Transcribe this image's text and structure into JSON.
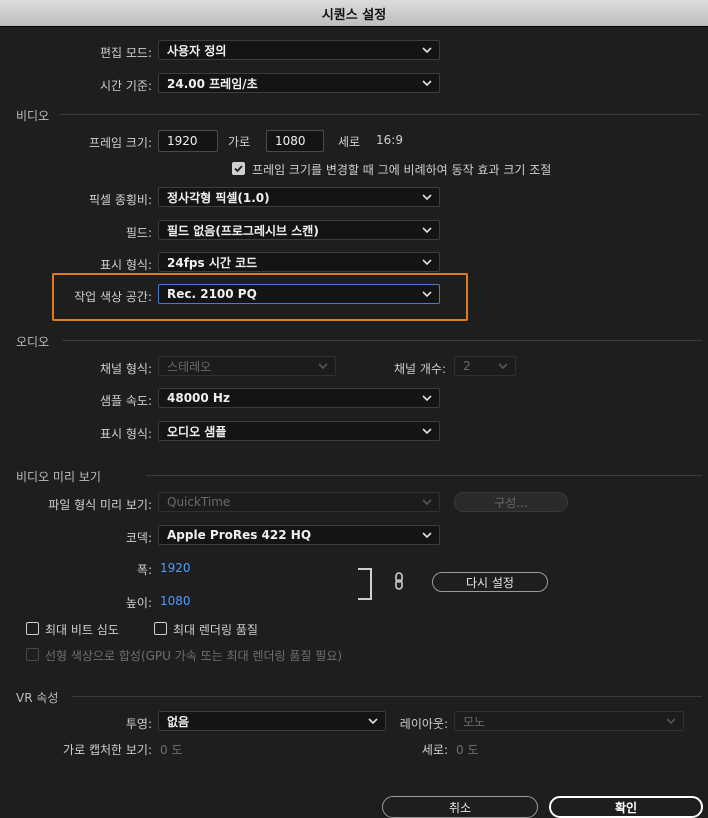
{
  "window": {
    "title": "시퀀스 설정"
  },
  "general": {
    "edit_mode_label": "편집 모드:",
    "edit_mode_value": "사용자 정의",
    "timebase_label": "시간 기준:",
    "timebase_value": "24.00  프레임/초"
  },
  "video": {
    "section_title": "비디오",
    "frame_size_label": "프레임 크기:",
    "frame_width": "1920",
    "horizontal_label": "가로",
    "frame_height": "1080",
    "vertical_label": "세로",
    "aspect": "16:9",
    "scale_checkbox_label": "프레임 크기를 변경할 때 그에 비례하여 동작 효과 크기 조절",
    "scale_checked": true,
    "pixel_aspect_label": "픽셀 종횡비:",
    "pixel_aspect_value": "정사각형 픽셀(1.0)",
    "fields_label": "필드:",
    "fields_value": "필드 없음(프로그레시브 스캔)",
    "display_format_label": "표시 형식:",
    "display_format_value": "24fps 시간 코드",
    "working_color_label": "작업 색상 공간:",
    "working_color_value": "Rec. 2100 PQ"
  },
  "audio": {
    "section_title": "오디오",
    "channel_format_label": "채널 형식:",
    "channel_format_value": "스테레오",
    "channel_count_label": "채널 개수:",
    "channel_count_value": "2",
    "sample_rate_label": "샘플 속도:",
    "sample_rate_value": "48000 Hz",
    "display_format_label": "표시 형식:",
    "display_format_value": "오디오 샘플"
  },
  "preview": {
    "section_title": "비디오 미리 보기",
    "file_format_label": "파일 형식 미리 보기:",
    "file_format_value": "QuickTime",
    "configure_label": "구성...",
    "codec_label": "코덱:",
    "codec_value": "Apple ProRes 422 HQ",
    "width_label": "폭:",
    "width_value": "1920",
    "height_label": "높이:",
    "height_value": "1080",
    "reset_label": "다시 설정",
    "max_bit_depth_label": "최대 비트 심도",
    "max_render_quality_label": "최대 렌더링 품질",
    "linear_color_label": "선형 색상으로 합성(GPU 가속 또는 최대 렌더링 품질 필요)"
  },
  "vr": {
    "section_title": "VR 속성",
    "projection_label": "투영:",
    "projection_value": "없음",
    "layout_label": "레이아웃:",
    "layout_value": "모노",
    "h_fov_label": "가로 캡처한 보기:",
    "h_fov_value": "0 도",
    "v_fov_label": "세로:",
    "v_fov_value": "0 도"
  },
  "footer": {
    "cancel_label": "취소",
    "ok_label": "확인"
  },
  "colors": {
    "highlight": "#e07b1e",
    "link_value": "#4a9cff"
  }
}
